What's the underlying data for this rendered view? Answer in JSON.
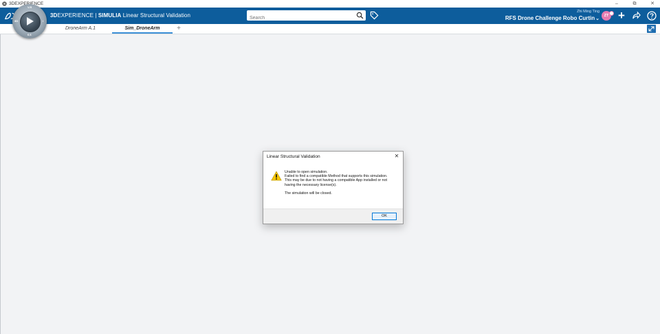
{
  "window": {
    "title": "3DEXPERIENCE",
    "controls": [
      "–",
      "⧉",
      "✕"
    ]
  },
  "header": {
    "brand_bold": "3D",
    "brand_mid": "EXPERIENCE",
    "brand_sep": " | ",
    "brand_app": "SIMULIA",
    "brand_module": " Linear Structural Validation",
    "search_placeholder": "Search",
    "user_name": "Zhi Ming Ting",
    "tenant": "RFS Drone Challenge Robo Curtin",
    "avatar_initials": "ZT",
    "plus_label": "+",
    "colors": {
      "bar": "#0d5d9c",
      "avatar": "#e77bb0",
      "active_tab": "#3b8fd6"
    }
  },
  "compass": {
    "north": "V.R",
    "west": "3D",
    "east": "i",
    "south": "6.6"
  },
  "tabs": [
    {
      "label": "DroneArm A.1",
      "active": false
    },
    {
      "label": "Sim_DroneArm",
      "active": true
    }
  ],
  "tab_add": "+",
  "dialog": {
    "title": "Linear Structural Validation",
    "close": "✕",
    "icon": "warning-icon",
    "lines": [
      "Unable to open simulation.",
      "Failed to find a compatible Method that supports this simulation.",
      "This may be due to not having a compatible App installed or not having the necessary license(s).",
      "The simulation will be closed."
    ],
    "ok_label": "OK"
  }
}
